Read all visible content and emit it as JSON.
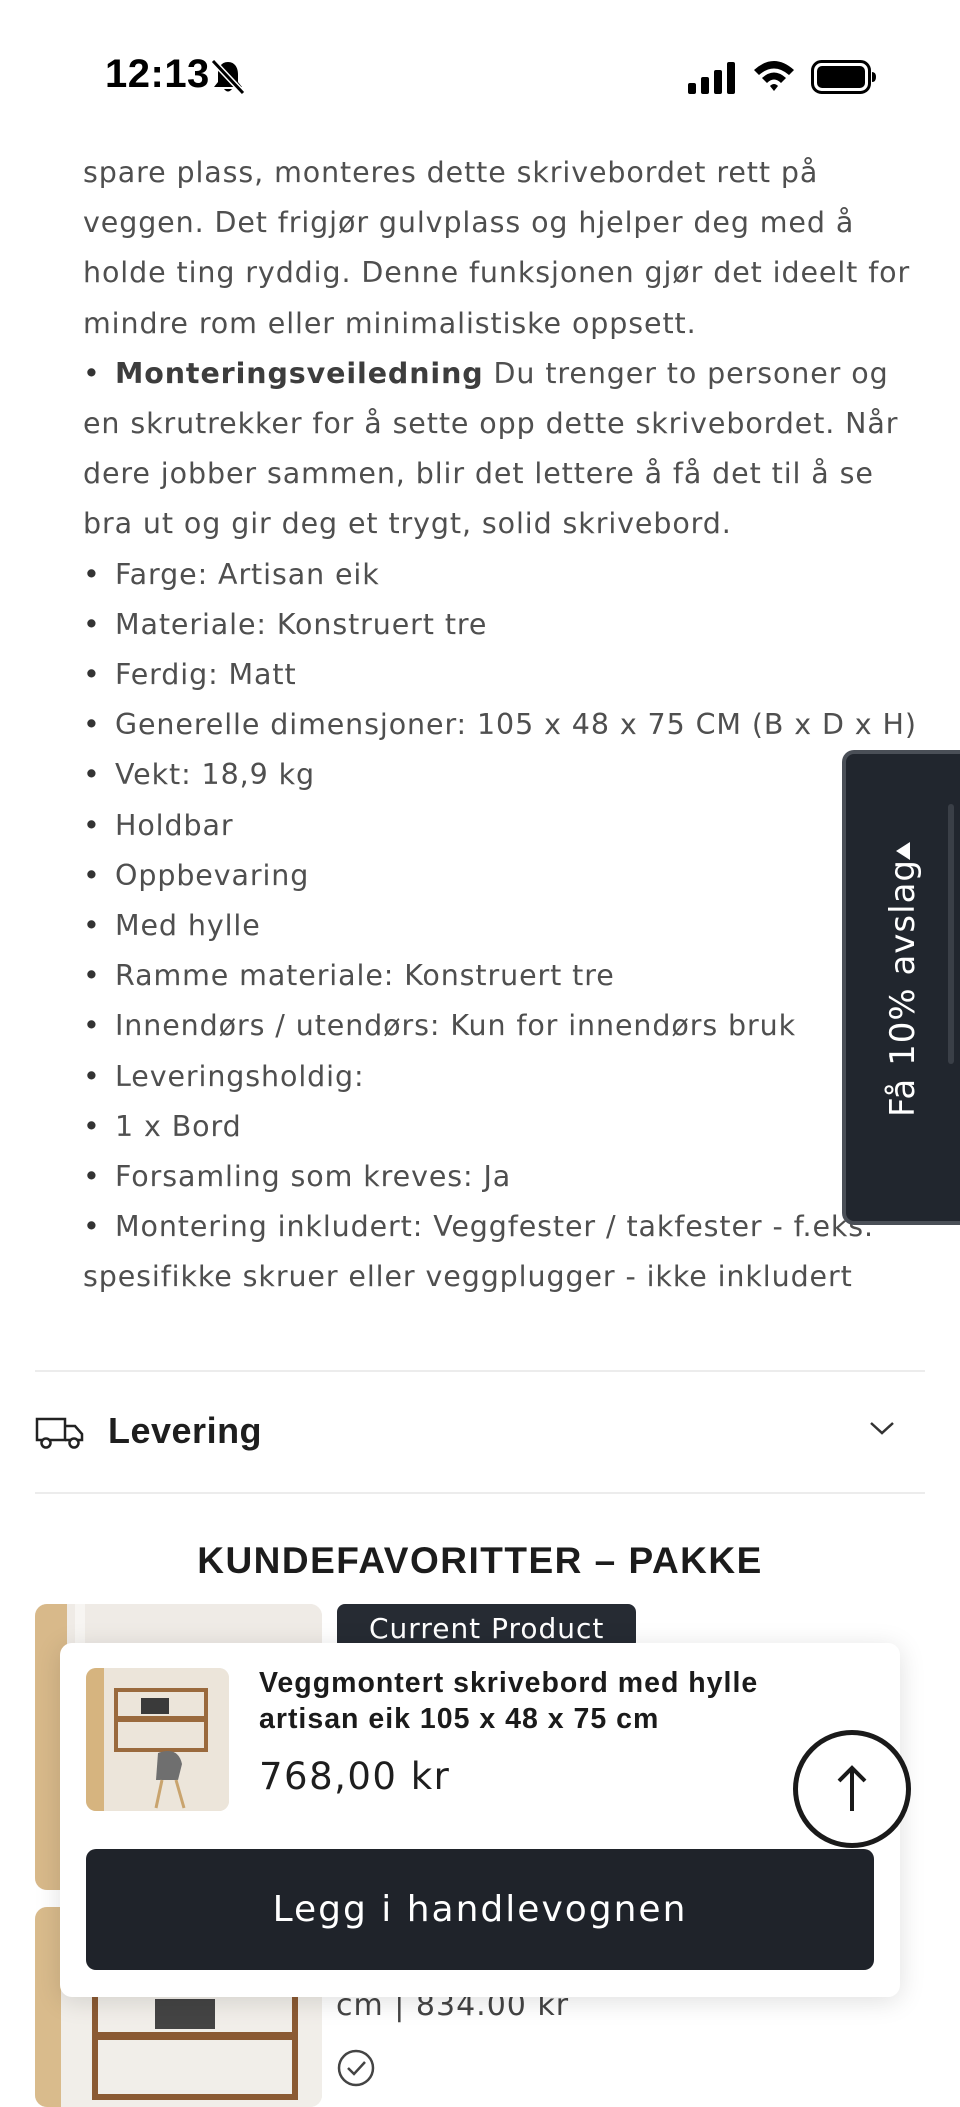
{
  "status_bar": {
    "time": "12:13"
  },
  "description": {
    "intro_lines": "spare plass, monteres dette skrivebordet rett på veggen. Det frigjør gulvplass og hjelper deg med å holde ting ryddig. Denne funksjonen gjør det ideelt for mindre rom eller minimalistiske oppsett.",
    "mounting_heading": "Monteringsveiledning",
    "mounting_text": " Du trenger to personer og en skrutrekker for å sette opp dette skrivebordet. Når dere jobber sammen, blir det lettere å få det til å se bra ut og gir deg et trygt, solid skrivebord.",
    "specs": [
      "Farge: Artisan eik",
      "Materiale: Konstruert tre",
      "Ferdig: Matt",
      "Generelle dimensjoner: 105 x 48 x 75 CM (B x D x H)",
      "Vekt: 18,9 kg",
      "Holdbar",
      "Oppbevaring",
      "Med hylle",
      "Ramme materiale: Konstruert tre",
      "Innendørs / utendørs: Kun for innendørs bruk",
      "Leveringsholdig:",
      "1 x Bord",
      "Forsamling som kreves: Ja"
    ],
    "last_spec": "Montering inkludert: Veggfester / takfester - f.eks. spesifikke skruer eller veggplugger - ikke inkludert"
  },
  "discount_tab": {
    "label": "Få 10% avslag"
  },
  "delivery_accordion": {
    "title": "Levering"
  },
  "bundle_section": {
    "title": "KUNDEFAVORITTER – PAKKE",
    "badge": "Current Product",
    "partial_text": "cm | 834.00 kr"
  },
  "sticky_cart": {
    "product_name": "Veggmontert skrivebord med hylle artisan eik 105 x 48 x 75 cm",
    "price": "768,00 kr",
    "button": "Legg i handlevognen"
  },
  "colors": {
    "dark": "#1f232a",
    "text": "#4f4f4f"
  }
}
